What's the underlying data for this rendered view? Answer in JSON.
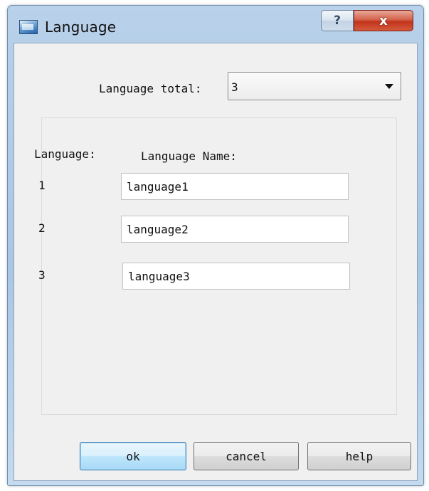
{
  "window": {
    "title": "Language",
    "help_button": "?",
    "close_button": "x"
  },
  "total": {
    "label": "Language total:",
    "value": "3"
  },
  "table": {
    "header_language": "Language:",
    "header_name": "Language Name:",
    "rows": [
      {
        "index": "1",
        "name": "language1"
      },
      {
        "index": "2",
        "name": "language2"
      },
      {
        "index": "3",
        "name": "language3"
      }
    ]
  },
  "buttons": {
    "ok": "ok",
    "cancel": "cancel",
    "help": "help"
  },
  "icons": {
    "app": "window-app-icon",
    "dropdown": "chevron-down-icon"
  }
}
